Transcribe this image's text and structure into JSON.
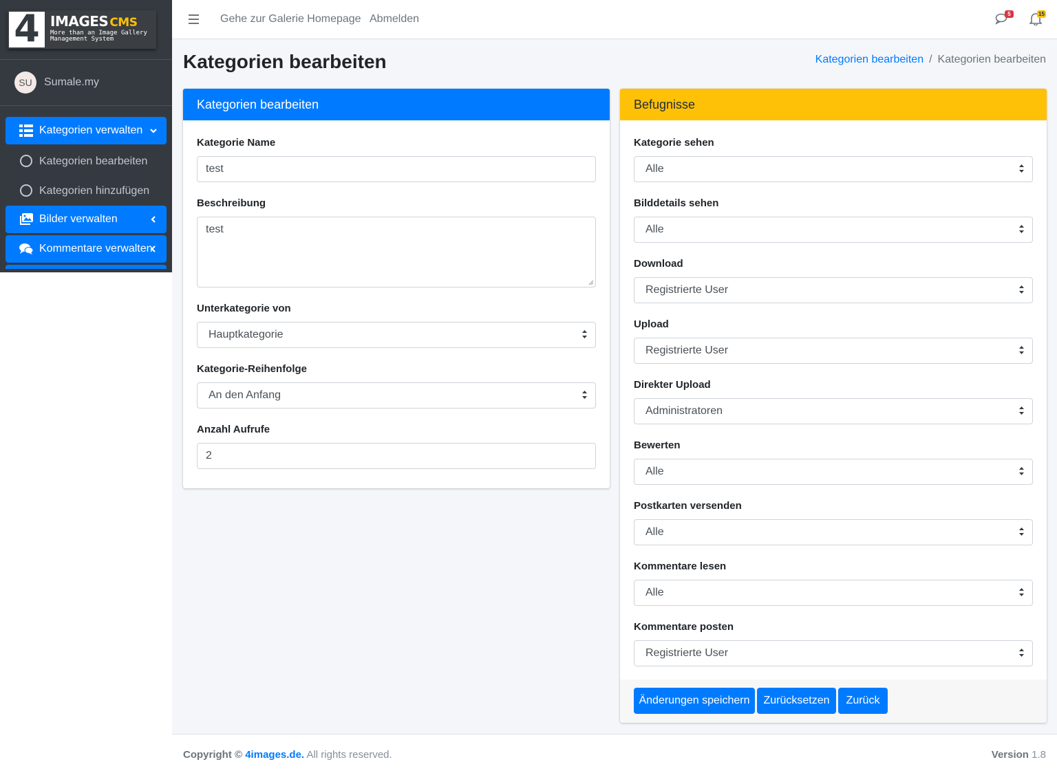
{
  "brand": {
    "logo_glyph": "4",
    "title": "IMAGES",
    "title_suffix": "CMS",
    "subtitle": "More than an Image Gallery Management System"
  },
  "user": {
    "initials": "SU",
    "name": "Sumale.my"
  },
  "sidebar": {
    "items": [
      {
        "label": "Kategorien verwalten",
        "icon": "table-list-icon",
        "state": "expanded"
      },
      {
        "label": "Kategorien bearbeiten",
        "icon": "circle-icon"
      },
      {
        "label": "Kategorien hinzufügen",
        "icon": "circle-icon"
      },
      {
        "label": "Bilder verwalten",
        "icon": "images-icon",
        "state": "collapsed"
      },
      {
        "label": "Kommentare verwalten",
        "icon": "comments-icon",
        "state": "collapsed"
      }
    ]
  },
  "topbar": {
    "links": [
      "Gehe zur Galerie Homepage",
      "Abmelden"
    ],
    "messages_badge": "5",
    "notifications_badge": "15"
  },
  "page": {
    "title": "Kategorien bearbeiten",
    "breadcrumb": [
      "Kategorien bearbeiten",
      "Kategorien bearbeiten"
    ]
  },
  "left_card": {
    "header": "Kategorien bearbeiten",
    "fields": {
      "name_label": "Kategorie Name",
      "name_value": "test",
      "desc_label": "Beschreibung",
      "desc_value": "test",
      "parent_label": "Unterkategorie von",
      "parent_value": "Hauptkategorie",
      "order_label": "Kategorie-Reihenfolge",
      "order_value": "An den Anfang",
      "hits_label": "Anzahl Aufrufe",
      "hits_value": "2"
    }
  },
  "right_card": {
    "header": "Befugnisse",
    "permissions": [
      {
        "label": "Kategorie sehen",
        "value": "Alle"
      },
      {
        "label": "Bilddetails sehen",
        "value": "Alle"
      },
      {
        "label": "Download",
        "value": "Registrierte User"
      },
      {
        "label": "Upload",
        "value": "Registrierte User"
      },
      {
        "label": "Direkter Upload",
        "value": "Administratoren"
      },
      {
        "label": "Bewerten",
        "value": "Alle"
      },
      {
        "label": "Postkarten versenden",
        "value": "Alle"
      },
      {
        "label": "Kommentare lesen",
        "value": "Alle"
      },
      {
        "label": "Kommentare posten",
        "value": "Registrierte User"
      }
    ],
    "buttons": {
      "save": "Änderungen speichern",
      "reset": "Zurücksetzen",
      "back": "Zurück"
    }
  },
  "footer": {
    "copyright_prefix": "Copyright ©",
    "copyright_link": "4images.de.",
    "copyright_suffix": "All rights reserved.",
    "version_label": "Version",
    "version_value": "1.8"
  },
  "colors": {
    "primary": "#007bff",
    "warning": "#ffc107",
    "sidebar": "#343a40",
    "danger": "#dc3545"
  }
}
